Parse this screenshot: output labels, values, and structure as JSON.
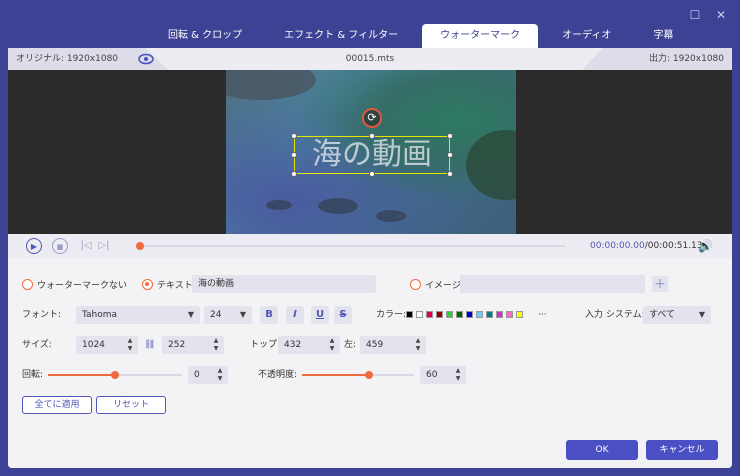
{
  "tabs": [
    {
      "label": "回転 & クロップ"
    },
    {
      "label": "エフェクト & フィルター"
    },
    {
      "label": "ウォーターマーク"
    },
    {
      "label": "オーディオ"
    },
    {
      "label": "字幕"
    }
  ],
  "info": {
    "original": "オリジナル: 1920x1080",
    "filename": "00015.mts",
    "output": "出力: 1920x1080"
  },
  "watermark_preview_text": "海の動画",
  "player": {
    "current_time": "00:00:00.00",
    "total_time": "/00:00:51.13",
    "progress": 0
  },
  "watermark": {
    "none_label": "ウォーターマークない",
    "text_label": "テキスト",
    "text_value": "海の動画",
    "image_label": "イメージ",
    "image_value": ""
  },
  "font": {
    "label": "フォント:",
    "family": "Tahoma",
    "size": "24",
    "bold": "B",
    "italic": "I",
    "underline": "U",
    "strike": "S"
  },
  "color": {
    "label": "カラー:",
    "swatches": [
      "#000000",
      "#ffffff",
      "#e0004d",
      "#8b0000",
      "#33cc33",
      "#006600",
      "#0000cc",
      "#66ccff",
      "#008080",
      "#cc33cc",
      "#ff66cc",
      "#ffff00"
    ],
    "more": "···"
  },
  "input_system": {
    "label": "入力 システム:",
    "value": "すべて"
  },
  "size": {
    "label": "サイズ:",
    "width": "1024",
    "height": "252"
  },
  "position": {
    "top_label": "トップ:",
    "top": "432",
    "left_label": "左:",
    "left": "459"
  },
  "rotation": {
    "label": "回転:",
    "value": "0",
    "level": 0.5
  },
  "opacity": {
    "label": "不透明度:",
    "value": "60",
    "level": 0.6
  },
  "buttons": {
    "apply_all": "全てに適用",
    "reset": "リセット",
    "ok": "OK",
    "cancel": "キャンセル"
  },
  "colors": {
    "accent": "#4b4fc4",
    "orange": "#f06a3f",
    "watermark_border": "#e6e600"
  }
}
